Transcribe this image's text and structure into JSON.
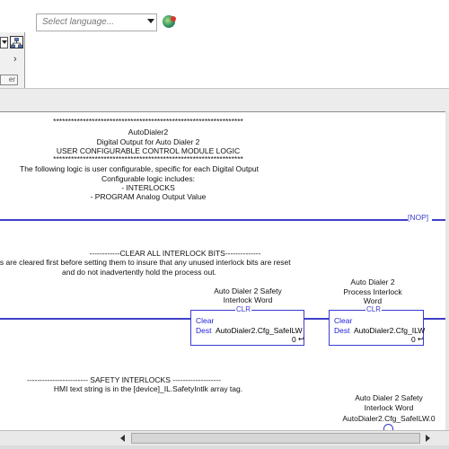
{
  "toolbar": {
    "language_placeholder": "Select language...",
    "er_button_label": "er"
  },
  "rung0": {
    "comment_lines": [
      "****************************************************************",
      "AutoDialer2",
      "Digital Output for Auto Dialer 2",
      "USER CONFIGURABLE CONTROL MODULE LOGIC",
      "****************************************************************",
      "The following logic is user configurable, specific for each Digital Output",
      "Configurable logic includes:",
      "- INTERLOCKS",
      "- PROGRAM Analog Output Value"
    ],
    "instruction": "NOP"
  },
  "rung1": {
    "comment_lines": [
      "------------CLEAR ALL INTERLOCK BITS--------------",
      "Bits are cleared first before setting them to insure that any unused interlock bits are reset",
      "and do not inadvertently hold the process out."
    ],
    "clr1": {
      "description": [
        "Auto Dialer 2 Safety",
        "Interlock Word"
      ],
      "name": "CLR",
      "clear_label": "Clear",
      "dest_label": "Dest",
      "dest_tag": "AutoDialer2.Cfg_SafeILW",
      "dest_value": "0"
    },
    "clr2": {
      "description": [
        "Auto Dialer 2",
        "Process Interlock",
        "Word"
      ],
      "name": "CLR",
      "clear_label": "Clear",
      "dest_label": "Dest",
      "dest_tag": "AutoDialer2.Cfg_ILW",
      "dest_value": "0"
    }
  },
  "rung2": {
    "comment_lines": [
      "------------------------ SAFETY INTERLOCKS -------------------",
      "HMI text string is in the [device]_IL.SafetyIntlk array tag."
    ],
    "contact": {
      "description": [
        "Auto Dialer 2 Safety",
        "Interlock Word"
      ],
      "tag": "AutoDialer2.Cfg_SafeILW.0"
    }
  }
}
